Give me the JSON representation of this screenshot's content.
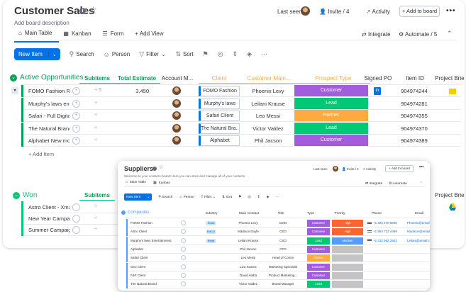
{
  "board": {
    "title": "Customer Sales",
    "description": "Add board description",
    "last_seen": "Last seen",
    "invite": "Invite / 4",
    "activity": "Activity",
    "add_to_board": "+ Add to board",
    "more": "•••",
    "tabs": [
      {
        "label": "Main Table",
        "icon": "table-icon"
      },
      {
        "label": "Kanban",
        "icon": "kanban-icon"
      },
      {
        "label": "Form",
        "icon": "form-icon"
      },
      {
        "label": "+ Add View",
        "icon": ""
      }
    ],
    "integrate": "Integrate",
    "automate": "Automate / 5",
    "toolbar": {
      "new_item": "New Item",
      "search": "Search",
      "person": "Person",
      "filter": "Filter",
      "sort": "Sort"
    }
  },
  "groups": {
    "active": {
      "title": "Active Opportunities",
      "color": "#00a359",
      "columns": {
        "subitems": "Subitems",
        "total_estimate": "Total Estimate",
        "account_manager": "Account M...",
        "client": "Client",
        "customer_main": "Customer Main...",
        "prospect_type": "Prospect Type",
        "signed_po": "Signed PO",
        "item_id": "Item ID",
        "project_brief": "Project Brief"
      },
      "rows": [
        {
          "name": "FOMO Fashion Re...",
          "subitems": "5",
          "estimate": "3,450",
          "client": "FOMO Fashion",
          "contact": "Phoenix Levy",
          "type": "Customer",
          "type_color": "#a25ddc",
          "po": true,
          "item_id": "904974244",
          "brief": true
        },
        {
          "name": "Murphy's laws ent...",
          "subitems": "",
          "estimate": "",
          "client": "Murphy's laws",
          "contact": "Leilani Krause",
          "type": "Lead",
          "type_color": "#00c875",
          "po": false,
          "item_id": "904974281",
          "brief": false
        },
        {
          "name": "Safari - Full Digital...",
          "subitems": "",
          "estimate": "",
          "client": "Safari Client",
          "contact": "Leo Messi",
          "type": "Partner",
          "type_color": "#fdab3d",
          "po": false,
          "item_id": "904974355",
          "brief": false
        },
        {
          "name": "The Natural Brand...",
          "subitems": "",
          "estimate": "",
          "client": "The Natural Bra...",
          "contact": "Victor Valdez",
          "type": "Lead",
          "type_color": "#00c875",
          "po": false,
          "item_id": "904974370",
          "brief": false
        },
        {
          "name": "Alphabet New mo...",
          "subitems": "",
          "estimate": "",
          "client": "Alphabet",
          "contact": "Phil Jacson",
          "type": "Customer",
          "type_color": "#a25ddc",
          "po": false,
          "item_id": "904974389",
          "brief": false
        }
      ],
      "add_item": "+ Add Item"
    },
    "won": {
      "title": "Won",
      "color": "#00c875",
      "subitems": "Subitems",
      "project_brief": "Project Brief",
      "rows": [
        {
          "name": "Astro Client - Xma..."
        },
        {
          "name": "New Year Campaign"
        },
        {
          "name": "Summer Campaign"
        }
      ]
    }
  },
  "suppliers": {
    "title": "Suppliers",
    "description": "Welcome to your contacts board! Here you can store and manage all of your contacts",
    "last_seen": "Last seen",
    "invite": "Invite / 1",
    "activity": "Activity",
    "add_to_board": "+ Add to board",
    "tabs": [
      {
        "label": "Main Table"
      },
      {
        "label": "Kanban"
      }
    ],
    "integrate": "Integrate",
    "automate": "Automate",
    "toolbar": {
      "new_item": "New Item",
      "search": "Search",
      "person": "Person",
      "filter": "Filter",
      "sort": "Sort"
    },
    "group_title": "Companies",
    "columns": {
      "industry": "Industry",
      "main_contact": "Main Contact",
      "title": "Title",
      "type": "Type",
      "priority": "Priority",
      "phone": "Phone",
      "email": "Email"
    },
    "rows": [
      {
        "company": "FOMO Fashion",
        "industry": "Retail",
        "contact": "Phoenix Levy",
        "title": "CMO",
        "type": "Customer",
        "type_color": "#a25ddc",
        "priority": "High",
        "prio_color": "#ff642e",
        "phone": "+1 325 478 5698",
        "email": "Phoenix@email.com"
      },
      {
        "company": "Astro Client",
        "industry": "FMCG",
        "contact": "Madison Doyle",
        "title": "CEO",
        "type": "Customer",
        "type_color": "#a25ddc",
        "priority": "High",
        "prio_color": "#ff642e",
        "phone": "+1 854 723 4499",
        "email": "Madison@email.com"
      },
      {
        "company": "Murphy's laws Entertainment",
        "industry": "Retail",
        "contact": "Leilani Krause",
        "title": "CSO",
        "type": "Lead",
        "type_color": "#00c875",
        "priority": "Medium",
        "prio_color": "#579bfc",
        "phone": "+1 312 562 2541",
        "email": "Leilani@email.com"
      },
      {
        "company": "Alphabet",
        "industry": "",
        "contact": "Phil Jacson",
        "title": "CFO",
        "type": "Customer",
        "type_color": "#a25ddc",
        "priority": "",
        "prio_color": "#c4c4c4",
        "phone": "",
        "email": ""
      },
      {
        "company": "Safari Client",
        "industry": "",
        "contact": "Leo Messi",
        "title": "Head of Comm",
        "type": "Partner",
        "type_color": "#fdab3d",
        "priority": "",
        "prio_color": "#c4c4c4",
        "phone": "",
        "email": ""
      },
      {
        "company": "Geo Client",
        "industry": "",
        "contact": "Liza Suarez",
        "title": "Marketing Specialist",
        "type": "Customer",
        "type_color": "#a25ddc",
        "priority": "",
        "prio_color": "#c4c4c4",
        "phone": "",
        "email": ""
      },
      {
        "company": "F&F Client",
        "industry": "",
        "contact": "David Alaba",
        "title": "Product Marketing...",
        "type": "Customer",
        "type_color": "#a25ddc",
        "priority": "",
        "prio_color": "#c4c4c4",
        "phone": "",
        "email": ""
      },
      {
        "company": "The Natural Brand",
        "industry": "",
        "contact": "Victor Valdez",
        "title": "Brand Manager",
        "type": "Lead",
        "type_color": "#00c875",
        "priority": "",
        "prio_color": "#c4c4c4",
        "phone": "",
        "email": ""
      }
    ]
  }
}
